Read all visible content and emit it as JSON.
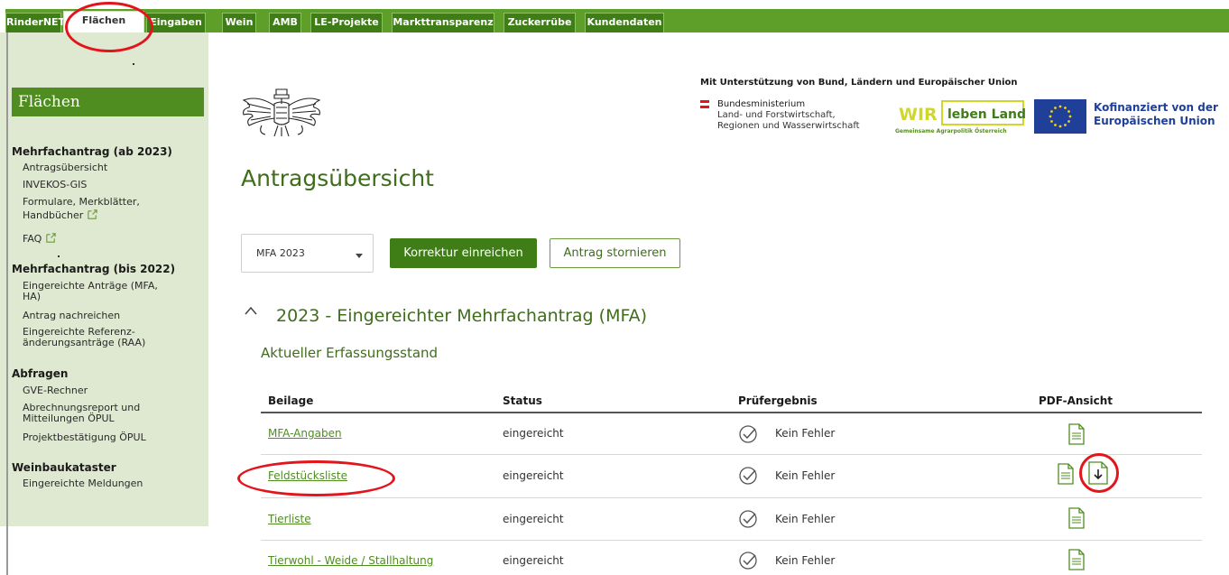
{
  "topnav": {
    "tabs": [
      {
        "label": "RinderNET"
      },
      {
        "label": "Flächen"
      },
      {
        "label": "Eingaben"
      },
      {
        "label": "Wein"
      },
      {
        "label": "AMB"
      },
      {
        "label": "LE-Projekte"
      },
      {
        "label": "Markttransparenz"
      },
      {
        "label": "Zuckerrübe"
      },
      {
        "label": "Kundendaten"
      }
    ],
    "active_tab": "Flächen"
  },
  "sidebar": {
    "title": "Flächen",
    "sections": [
      {
        "title": "Mehrfachantrag (ab 2023)",
        "items": [
          "Antragsübersicht",
          "INVEKOS-GIS",
          "Formulare, Merkblätter,",
          "Handbücher",
          "FAQ"
        ]
      },
      {
        "title": "Mehrfachantrag (bis 2022)",
        "items": [
          "Eingereichte Anträge (MFA,",
          "HA)",
          "Antrag nachreichen",
          "Eingereichte Referenz-",
          "änderungsanträge (RAA)"
        ]
      },
      {
        "title": "Abfragen",
        "items": [
          "GVE-Rechner",
          "Abrechnungsreport und",
          "Mitteilungen ÖPUL",
          "Projektbestätigung ÖPUL"
        ]
      },
      {
        "title": "Weinbaukataster",
        "items": [
          "Eingereichte Meldungen"
        ]
      }
    ]
  },
  "header": {
    "support_text": "Mit Unterstützung von Bund, Ländern und Europäischer Union",
    "ministry": [
      "Bundesministerium",
      "Land- und Forstwirtschaft,",
      "Regionen und Wasserwirtschaft"
    ],
    "wir_logo": {
      "wir": "WIR",
      "rest": "leben Land",
      "sub": "Gemeinsame Agrarpolitik Österreich"
    },
    "eu_text": [
      "Kofinanziert von der",
      "Europäischen Union"
    ]
  },
  "main": {
    "title": "Antragsübersicht",
    "year_select": "MFA 2023",
    "btn_correct": "Korrektur einreichen",
    "btn_cancel": "Antrag stornieren",
    "section_title": "2023 - Eingereichter Mehrfachantrag (MFA)",
    "subsection_title": "Aktueller Erfassungsstand"
  },
  "table": {
    "headers": [
      "Beilage",
      "Status",
      "Prüfergebnis",
      "PDF-Ansicht"
    ],
    "rows": [
      {
        "beilage": "MFA-Angaben",
        "status": "eingereicht",
        "result": "Kein Fehler",
        "download": false
      },
      {
        "beilage": "Feldstücksliste",
        "status": "eingereicht",
        "result": "Kein Fehler",
        "download": true
      },
      {
        "beilage": "Tierliste",
        "status": "eingereicht",
        "result": "Kein Fehler",
        "download": false
      },
      {
        "beilage": "Tierwohl - Weide / Stallhaltung",
        "status": "eingereicht",
        "result": "Kein Fehler",
        "download": false
      }
    ]
  },
  "colors": {
    "brand_green": "#3f7d17",
    "title_green": "#3f6d1c",
    "highlight_red": "#e3141b",
    "eu_blue": "#1f3f99"
  },
  "icons": [
    "external-link-icon",
    "check-circle-icon",
    "pdf-document-icon",
    "pdf-download-icon",
    "chevron-up-icon",
    "chevron-down-icon",
    "austrian-eagle-logo",
    "eu-flag-logo"
  ]
}
